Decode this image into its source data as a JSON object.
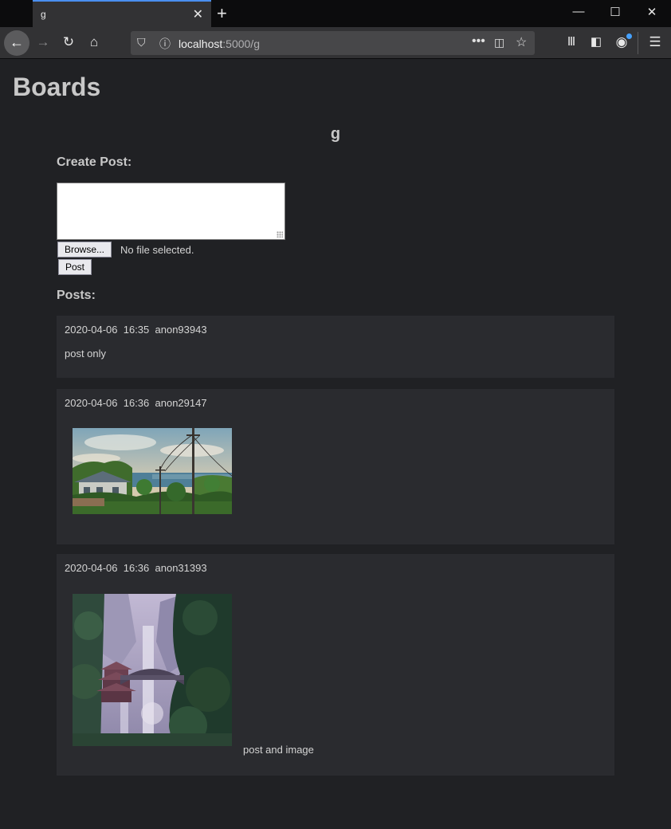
{
  "browser": {
    "tab_title": "g",
    "tab_close": "✕",
    "new_tab": "+",
    "url_host": "localhost",
    "url_path": ":5000/g",
    "accent": "#4a8ff0"
  },
  "page": {
    "heading": "Boards",
    "board_name": "g",
    "create_post_label": "Create Post:",
    "browse_label": "Browse...",
    "file_status": "No file selected.",
    "post_button": "Post",
    "posts_label": "Posts:"
  },
  "posts": [
    {
      "date": "2020-04-06",
      "time": "16:35",
      "author": "anon93943",
      "text": "post only",
      "image": null
    },
    {
      "date": "2020-04-06",
      "time": "16:36",
      "author": "anon29147",
      "text": "",
      "image": "coastal-town-painting"
    },
    {
      "date": "2020-04-06",
      "time": "16:36",
      "author": "anon31393",
      "text": "post and image",
      "image": "waterfall-temple-pixel-art"
    }
  ]
}
